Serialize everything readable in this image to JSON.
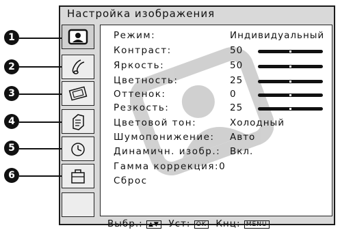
{
  "menu": {
    "title": "Настройка изображения"
  },
  "tabs": [
    {
      "icon": "picture-icon",
      "callout": "1",
      "active": true
    },
    {
      "icon": "sound-icon",
      "callout": "2",
      "active": false
    },
    {
      "icon": "screen-icon",
      "callout": "3",
      "active": false
    },
    {
      "icon": "settings-icon",
      "callout": "4",
      "active": false
    },
    {
      "icon": "timer-icon",
      "callout": "5",
      "active": false
    },
    {
      "icon": "setup-icon",
      "callout": "6",
      "active": false
    }
  ],
  "settings": [
    {
      "label": "Режим:",
      "value": "Индивидуальный"
    },
    {
      "label": "Контраст:",
      "value": "50",
      "level": 0.5
    },
    {
      "label": "Яркость:",
      "value": "50",
      "level": 0.5
    },
    {
      "label": "Цветность:",
      "value": "25",
      "level": 0.5
    },
    {
      "label": "Оттенок:",
      "value": "0",
      "level": 0.5
    },
    {
      "label": "Резкость:",
      "value": "25",
      "level": 0.5
    },
    {
      "label": "Цветовой тон:",
      "value": "Холодный"
    },
    {
      "label": "Шумопонижение:",
      "value": "Авто"
    },
    {
      "label": "Динамичн. изобр.:",
      "value": "Вкл."
    },
    {
      "label": "Гамма коррекция:",
      "value": "0"
    },
    {
      "label": "Сброс",
      "value": ""
    }
  ],
  "footer": {
    "select_label": "Выбр.:",
    "set_label": "Уст:",
    "ok_key": "OK",
    "exit_label": "Кнц:",
    "menu_key": "MENU"
  }
}
